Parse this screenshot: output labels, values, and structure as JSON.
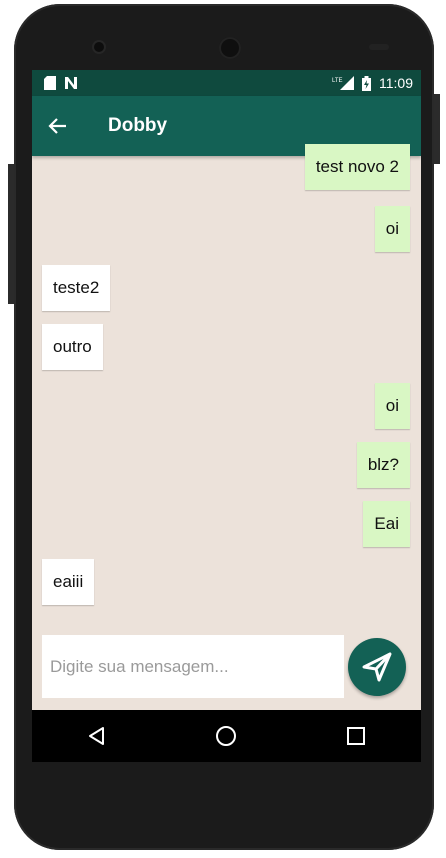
{
  "status": {
    "time": "11:09",
    "network": "LTE"
  },
  "header": {
    "title": "Dobby"
  },
  "messages": [
    {
      "text": "test novo 2",
      "from": "me"
    },
    {
      "text": "oi",
      "from": "me"
    },
    {
      "text": "teste2",
      "from": "them"
    },
    {
      "text": "outro",
      "from": "them"
    },
    {
      "text": "oi",
      "from": "me"
    },
    {
      "text": "blz?",
      "from": "me"
    },
    {
      "text": "Eai",
      "from": "me"
    },
    {
      "text": "eaiii",
      "from": "them"
    }
  ],
  "composer": {
    "placeholder": "Digite sua mensagem...",
    "value": ""
  },
  "colors": {
    "primary": "#136155",
    "status_bar": "#0f4a3e",
    "chat_bg": "#ece2da",
    "sent_bubble": "#d9f7c4",
    "received_bubble": "#ffffff"
  },
  "icons": {
    "back": "arrow-left-icon",
    "send": "paper-plane-icon",
    "nav_back": "triangle-back-icon",
    "nav_home": "circle-home-icon",
    "nav_recents": "square-recents-icon"
  }
}
